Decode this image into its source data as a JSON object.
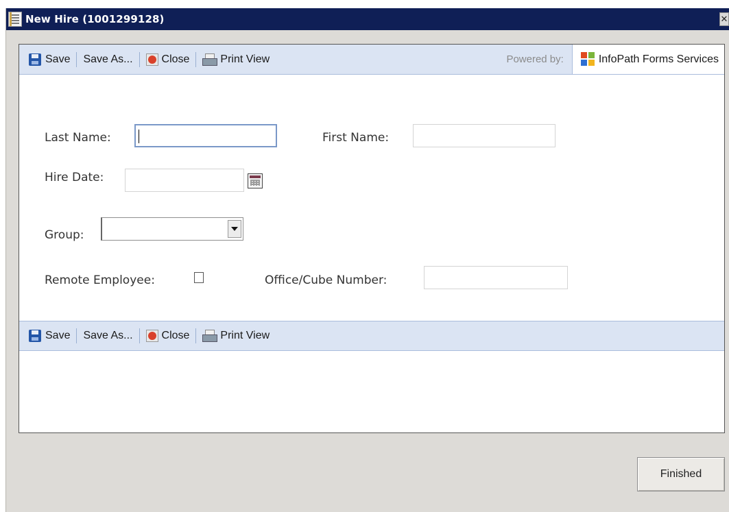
{
  "window": {
    "title": "New Hire (1001299128)",
    "close_glyph": "✕"
  },
  "toolbar": {
    "save_label": "Save",
    "save_as_label": "Save As...",
    "close_label": "Close",
    "print_view_label": "Print View",
    "powered_by_label": "Powered by:",
    "infopath_label": "InfoPath Forms Services",
    "icons": [
      "save-icon",
      "close-document-icon",
      "printer-icon",
      "infopath-logo-icon"
    ]
  },
  "form": {
    "last_name": {
      "label": "Last Name:",
      "value": ""
    },
    "first_name": {
      "label": "First Name:",
      "value": ""
    },
    "hire_date": {
      "label": "Hire Date:",
      "value": "",
      "icon": "calendar-icon"
    },
    "group": {
      "label": "Group:",
      "selected": ""
    },
    "remote_employee": {
      "label": "Remote Employee:",
      "checked": false
    },
    "office_cube": {
      "label": "Office/Cube Number:",
      "value": ""
    }
  },
  "footer": {
    "finished_label": "Finished"
  },
  "colors": {
    "title_bar": "#0f1f56",
    "toolbar_bg": "#dbe4f3",
    "dialog_bg": "#dddbd7"
  }
}
